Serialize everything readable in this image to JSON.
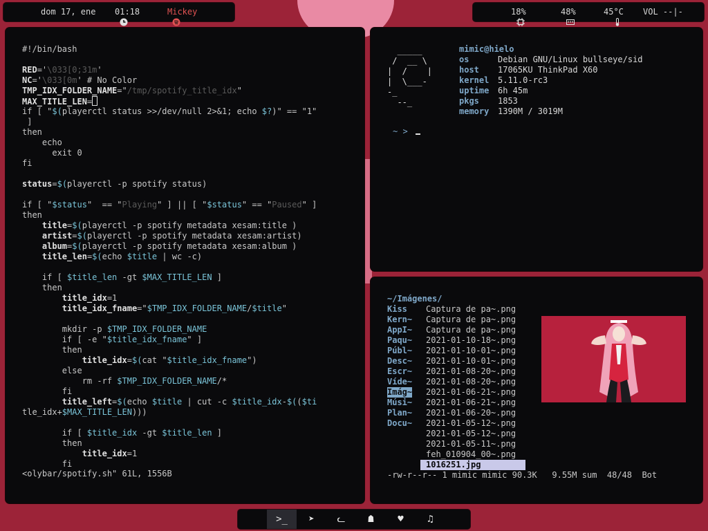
{
  "top_left": {
    "date": "dom 17, ene",
    "time": "01:18",
    "player_label": "Mickey"
  },
  "top_right": {
    "cpu": "18%",
    "mem": "48%",
    "temp": "45°C",
    "vol": "VOL --|-"
  },
  "editor": {
    "lines": [
      {
        "t": "#!/bin/bash"
      },
      {
        "t": ""
      },
      {
        "t": "RED='\\033[0;31m'"
      },
      {
        "t": "NC='\\033[0m' # No Color"
      },
      {
        "t": "TMP_IDX_FOLDER_NAME=\"/tmp/spotify_title_idx\""
      },
      {
        "t": "MAX_TITLE_LEN=1"
      },
      {
        "t": "if [ \"$(playerctl status >>/dev/null 2>&1; echo $?)\" == \"1\""
      },
      {
        "t": " ]"
      },
      {
        "t": "then"
      },
      {
        "t": "    echo"
      },
      {
        "t": "      exit 0"
      },
      {
        "t": "fi"
      },
      {
        "t": ""
      },
      {
        "t": "status=$(playerctl -p spotify status)"
      },
      {
        "t": ""
      },
      {
        "t": "if [ \"$status\"  == \"Playing\" ] || [ \"$status\" == \"Paused\" ]"
      },
      {
        "t": "then"
      },
      {
        "t": "    title=$(playerctl -p spotify metadata xesam:title )"
      },
      {
        "t": "    artist=$(playerctl -p spotify metadata xesam:artist)"
      },
      {
        "t": "    album=$(playerctl -p spotify metadata xesam:album )"
      },
      {
        "t": "    title_len=$(echo $title | wc -c)"
      },
      {
        "t": ""
      },
      {
        "t": "    if [ $title_len -gt $MAX_TITLE_LEN ]"
      },
      {
        "t": "    then"
      },
      {
        "t": "        title_idx=1"
      },
      {
        "t": "        title_idx_fname=\"$TMP_IDX_FOLDER_NAME/$title\""
      },
      {
        "t": ""
      },
      {
        "t": "        mkdir -p $TMP_IDX_FOLDER_NAME"
      },
      {
        "t": "        if [ -e \"$title_idx_fname\" ]"
      },
      {
        "t": "        then"
      },
      {
        "t": "            title_idx=$(cat \"$title_idx_fname\")"
      },
      {
        "t": "        else"
      },
      {
        "t": "            rm -rf $TMP_IDX_FOLDER_NAME/*"
      },
      {
        "t": "        fi"
      },
      {
        "t": "        title_left=$(echo $title | cut -c $title_idx-$(($ti"
      },
      {
        "t": "tle_idx+$MAX_TITLE_LEN)))"
      },
      {
        "t": ""
      },
      {
        "t": "        if [ $title_idx -gt $title_len ]"
      },
      {
        "t": "        then"
      },
      {
        "t": "            title_idx=1"
      },
      {
        "t": "        fi"
      }
    ],
    "status": "<olybar/spotify.sh\" 61L, 1556B"
  },
  "fetch": {
    "ascii": "  _____\n /  __ \\\n|  /    |\n|  \\___-\n-_\n  --_",
    "user": "mimic@hielo",
    "rows": [
      {
        "k": "os",
        "v": "Debian GNU/Linux bullseye/sid"
      },
      {
        "k": "host",
        "v": "17065KU ThinkPad X60"
      },
      {
        "k": "kernel",
        "v": "5.11.0-rc3"
      },
      {
        "k": "uptime",
        "v": "6h 45m"
      },
      {
        "k": "pkgs",
        "v": "1853"
      },
      {
        "k": "memory",
        "v": "1390M / 3019M"
      }
    ],
    "prompt": "~ >"
  },
  "ranger": {
    "path": "~/Imágenes/",
    "dirs": [
      "Kiss",
      "Kern~",
      "AppI~",
      "Paqu~",
      "Públ~",
      "Desc~",
      "Escr~",
      "Víde~",
      "Imág~",
      "Músi~",
      "Plan~",
      "Docu~"
    ],
    "selected_dir_index": 8,
    "files": [
      "Captura de pa~.png",
      "Captura de pa~.png",
      "Captura de pa~.png",
      "2021-01-10-18~.png",
      "2021-01-10-01~.png",
      "2021-01-10-01~.png",
      "2021-01-08-20~.png",
      "2021-01-08-20~.png",
      "2021-01-06-21~.png",
      "2021-01-06-21~.png",
      "2021-01-06-20~.png",
      "2021-01-05-12~.png",
      "2021-01-05-12~.png",
      "2021-01-05-11~.png",
      "feh_010904_00~.png"
    ],
    "selected_file": "1016251.jpg",
    "status": "-rw-r--r-- 1 mimic mimic 90.3K   9.55M sum  48/48  Bot"
  },
  "dock": {
    "items": [
      {
        "name": "terminal-icon",
        "glyph": ">_"
      },
      {
        "name": "telegram-icon",
        "glyph": "➤"
      },
      {
        "name": "cat-icon",
        "glyph": "ᓚ"
      },
      {
        "name": "ghost-icon",
        "glyph": "☗"
      },
      {
        "name": "heart-icon",
        "glyph": "♥"
      },
      {
        "name": "music-icon",
        "glyph": "♫"
      }
    ],
    "active_index": 0
  },
  "colors": {
    "background": "#9c2338",
    "panel": "#0a0a0c",
    "accent_blue": "#7fa8c9",
    "red_text": "#e05252"
  }
}
